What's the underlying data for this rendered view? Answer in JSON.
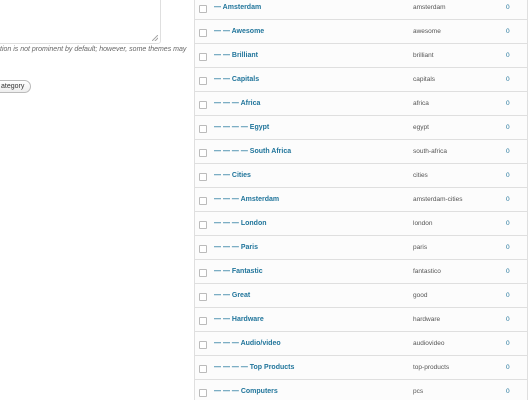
{
  "left_form": {
    "description_note": "tion is not prominent by default; however, some themes may",
    "add_button_label": "ategory"
  },
  "categories": [
    {
      "name": "— Amsterdam",
      "slug": "amsterdam",
      "count": "0"
    },
    {
      "name": "— — Awesome",
      "slug": "awesome",
      "count": "0"
    },
    {
      "name": "— — Brilliant",
      "slug": "brilliant",
      "count": "0"
    },
    {
      "name": "— — Capitals",
      "slug": "capitals",
      "count": "0"
    },
    {
      "name": "— — — Africa",
      "slug": "africa",
      "count": "0"
    },
    {
      "name": "— — — — Egypt",
      "slug": "egypt",
      "count": "0"
    },
    {
      "name": "— — — — South Africa",
      "slug": "south-africa",
      "count": "0"
    },
    {
      "name": "— — Cities",
      "slug": "cities",
      "count": "0"
    },
    {
      "name": "— — — Amsterdam",
      "slug": "amsterdam-cities",
      "count": "0"
    },
    {
      "name": "— — — London",
      "slug": "london",
      "count": "0"
    },
    {
      "name": "— — — Paris",
      "slug": "paris",
      "count": "0"
    },
    {
      "name": "— — Fantastic",
      "slug": "fantastico",
      "count": "0"
    },
    {
      "name": "— — Great",
      "slug": "good",
      "count": "0"
    },
    {
      "name": "— — Hardware",
      "slug": "hardware",
      "count": "0"
    },
    {
      "name": "— — — Audio/video",
      "slug": "audiovideo",
      "count": "0"
    },
    {
      "name": "— — — — Top Products",
      "slug": "top-products",
      "count": "0"
    },
    {
      "name": "— — — Computers",
      "slug": "pcs",
      "count": "0"
    }
  ],
  "colors": {
    "link": "#21759b",
    "border": "#dfdfdf",
    "row_bg": "#fcfcfc"
  }
}
